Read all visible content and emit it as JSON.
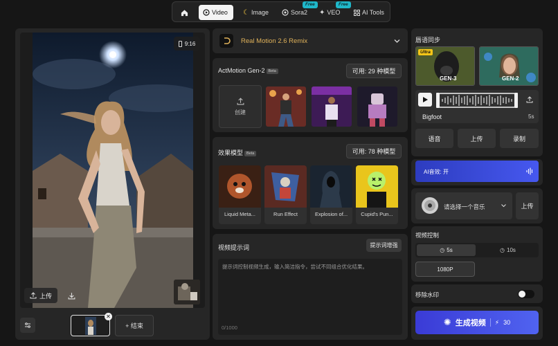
{
  "nav": {
    "video": "Video",
    "image": "Image",
    "sora2": "Sora2",
    "veo": "VEO",
    "ai_tools": "AI Tools",
    "free_badge": "Free"
  },
  "preview": {
    "aspect_ratio": "9:16",
    "upload_label": "上传",
    "end_label": "+ 结束"
  },
  "model": {
    "name": "Real Motion 2.6 Remix"
  },
  "actmotion": {
    "title": "ActMotion Gen-2",
    "beta": "Beta",
    "available": "可用: 29 种模型",
    "create_label": "创建"
  },
  "effects": {
    "title": "效果模型",
    "beta": "Beta",
    "available": "可用: 78 种模型",
    "items": [
      "Liquid Meta...",
      "Run Effect",
      "Explosion of...",
      "Cupid's Pun..."
    ]
  },
  "prompt": {
    "title": "视频提示词",
    "enhance": "提示词增强",
    "placeholder": "提示词控制视频生成，输入简洁指令，尝试不同组合优化结果。",
    "counter": "0/1000"
  },
  "lipsync": {
    "title": "唇语同步",
    "gen3": "GEN-3",
    "gen2": "GEN-2",
    "ultra": "Ultra",
    "voice_name": "Bigfoot",
    "duration": "5s",
    "voice_btn": "语音",
    "upload_btn": "上传",
    "record_btn": "录制"
  },
  "ai_sound": {
    "label": "AI音效: 开"
  },
  "music": {
    "placeholder": "请选择一个音乐",
    "upload": "上传"
  },
  "video_control": {
    "title": "视频控制",
    "d5": "5s",
    "d10": "10s",
    "resolution": "1080P"
  },
  "watermark": {
    "label": "移除水印"
  },
  "generate": {
    "label": "生成视频",
    "cost": "30"
  },
  "colors": {
    "accent_blue": "#4a5cf0",
    "free_badge": "#1fb7c9",
    "model_gold": "#e0b25a"
  }
}
